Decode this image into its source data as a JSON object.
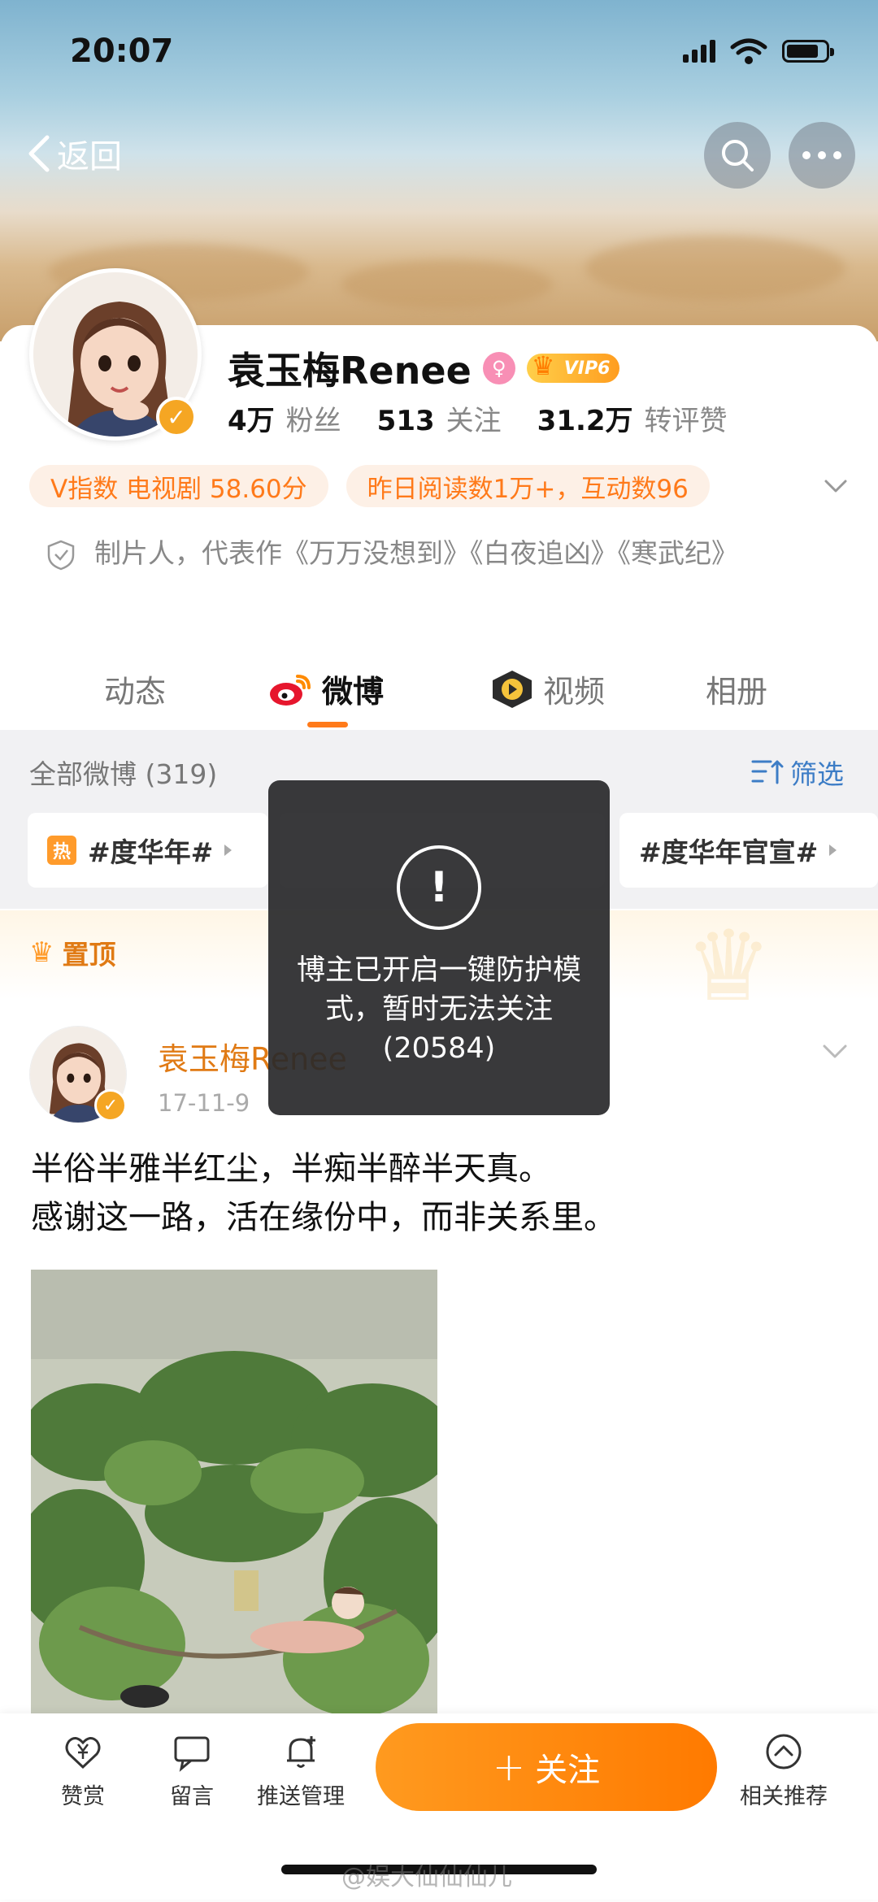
{
  "status_bar": {
    "time": "20:07"
  },
  "nav": {
    "back_label": "返回"
  },
  "profile": {
    "name": "袁玉梅Renee",
    "vip_label": "VIP6",
    "stats": [
      {
        "value": "4万",
        "label": "粉丝"
      },
      {
        "value": "513",
        "label": "关注"
      },
      {
        "value": "31.2万",
        "label": "转评赞"
      }
    ],
    "pills": [
      "V指数 电视剧 58.60分",
      "昨日阅读数1万+，互动数96"
    ],
    "description": "制片人，代表作《万万没想到》《白夜追凶》《寒武纪》"
  },
  "tabs": [
    {
      "label": "动态",
      "active": false
    },
    {
      "label": "微博",
      "active": true
    },
    {
      "label": "视频",
      "active": false
    },
    {
      "label": "相册",
      "active": false
    }
  ],
  "feed": {
    "header": "全部微博 (319)",
    "filter_label": "筛选",
    "topics": [
      "#度华年#",
      "#度华年官宣#"
    ],
    "pinned_label": "置顶",
    "post": {
      "author": "袁玉梅Renee",
      "meta": "17-11-9",
      "text_line1": "半俗半雅半红尘，半痴半醉半天真。",
      "text_line2": "感谢这一路，活在缘份中，而非关系里。"
    }
  },
  "toast": {
    "icon": "!",
    "message": "博主已开启一键防护模式，暂时无法关注(20584)"
  },
  "bottom_bar": {
    "items": [
      "赞赏",
      "留言",
      "推送管理",
      "相关推荐"
    ],
    "follow_label": "关注",
    "follow_plus": "+"
  },
  "watermark": "@娱大仙仙仙儿",
  "colors": {
    "accent": "#ff7a1a",
    "link": "#3d7dc6",
    "verified": "#f5a623"
  }
}
